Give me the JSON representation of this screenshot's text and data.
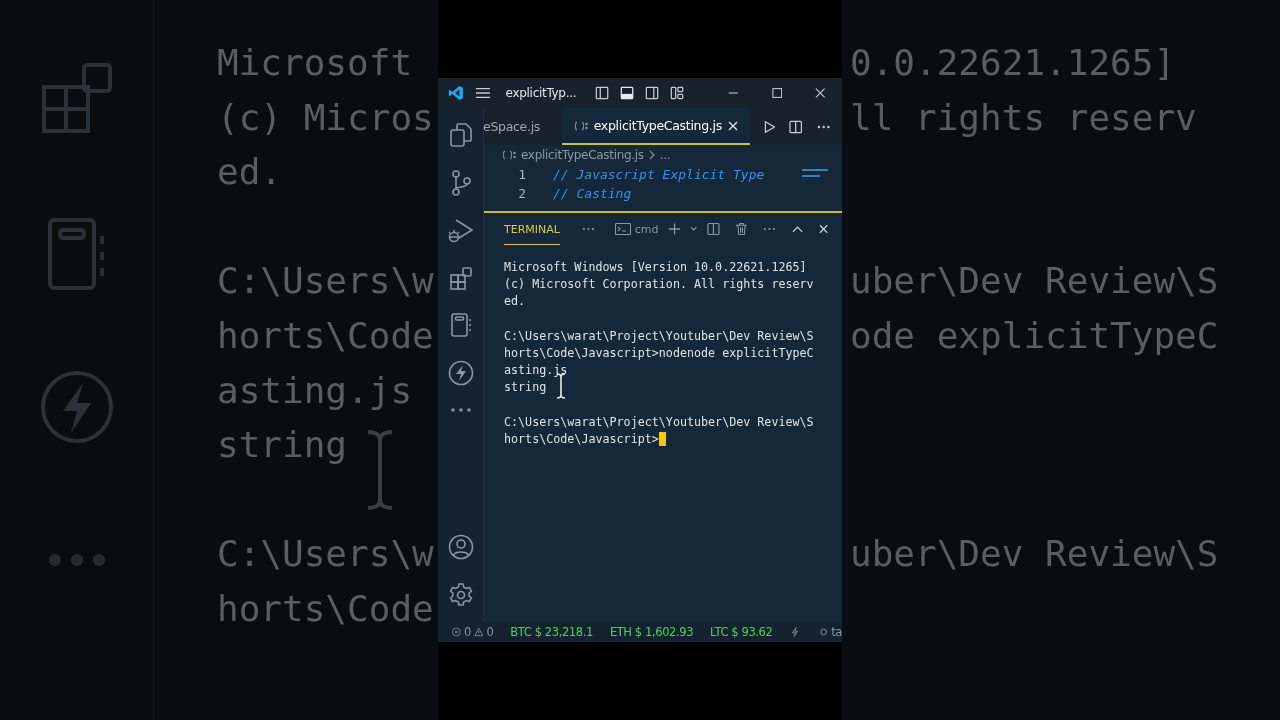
{
  "backdrop": {
    "blocks": [
      {
        "rows": [
          {
            "left": "Microsoft",
            "right": "0.0.22621.1265]"
          },
          {
            "left": "(c) Micros",
            "right": "ll rights reserv"
          },
          {
            "left": "ed."
          }
        ]
      },
      {
        "rows": [
          {
            "left": "C:\\Users\\w",
            "right": "uber\\Dev Review\\S"
          },
          {
            "left": "horts\\Code",
            "right": "ode explicitTypeC"
          },
          {
            "left": "asting.js"
          },
          {
            "left": "string"
          }
        ]
      },
      {
        "rows": [
          {
            "left": "C:\\Users\\w",
            "right": "uber\\Dev Review\\S"
          },
          {
            "left": "horts\\Code"
          }
        ]
      }
    ]
  },
  "window": {
    "title": "explicitTyp..."
  },
  "tabs": [
    {
      "label": "eSpace.js",
      "selected": false
    },
    {
      "label": "explicitTypeCasting.js",
      "selected": true
    }
  ],
  "breadcrumb": {
    "file": "explicitTypeCasting.js",
    "more": "..."
  },
  "editor": {
    "lines": [
      {
        "number": "1",
        "text": "// Javascript Explicit Type"
      },
      {
        "number": "2",
        "text": "// Casting"
      }
    ]
  },
  "panel": {
    "tabs": [
      {
        "label": "TERMINAL",
        "selected": true
      }
    ],
    "shell": "cmd",
    "blocks": [
      {
        "lines": [
          {
            "text": "Microsoft Windows [Version 10.0.22621.1265]",
            "cursor": false
          },
          {
            "text": "(c) Microsoft Corporation. All rights reserv",
            "cursor": false
          },
          {
            "text": "ed.",
            "cursor": false
          }
        ]
      },
      {
        "lines": [
          {
            "text": "C:\\Users\\warat\\Project\\Youtuber\\Dev Review\\S",
            "cursor": false
          },
          {
            "text": "horts\\Code\\Javascript>nodenode explicitTypeC",
            "cursor": false
          },
          {
            "text": "asting.js",
            "cursor": false
          },
          {
            "text": "string",
            "cursor": false
          }
        ]
      },
      {
        "lines": [
          {
            "text": "C:\\Users\\warat\\Project\\Youtuber\\Dev Review\\S",
            "cursor": false
          },
          {
            "text": "horts\\Code\\Javascript>",
            "cursor": true
          }
        ]
      }
    ]
  },
  "status_bar": {
    "errors": "0",
    "warnings": "0",
    "tickers": [
      "BTC $ 23,218.1",
      "ETH $ 1,602.93",
      "LTC $ 93.62"
    ],
    "trailing": "ta"
  }
}
